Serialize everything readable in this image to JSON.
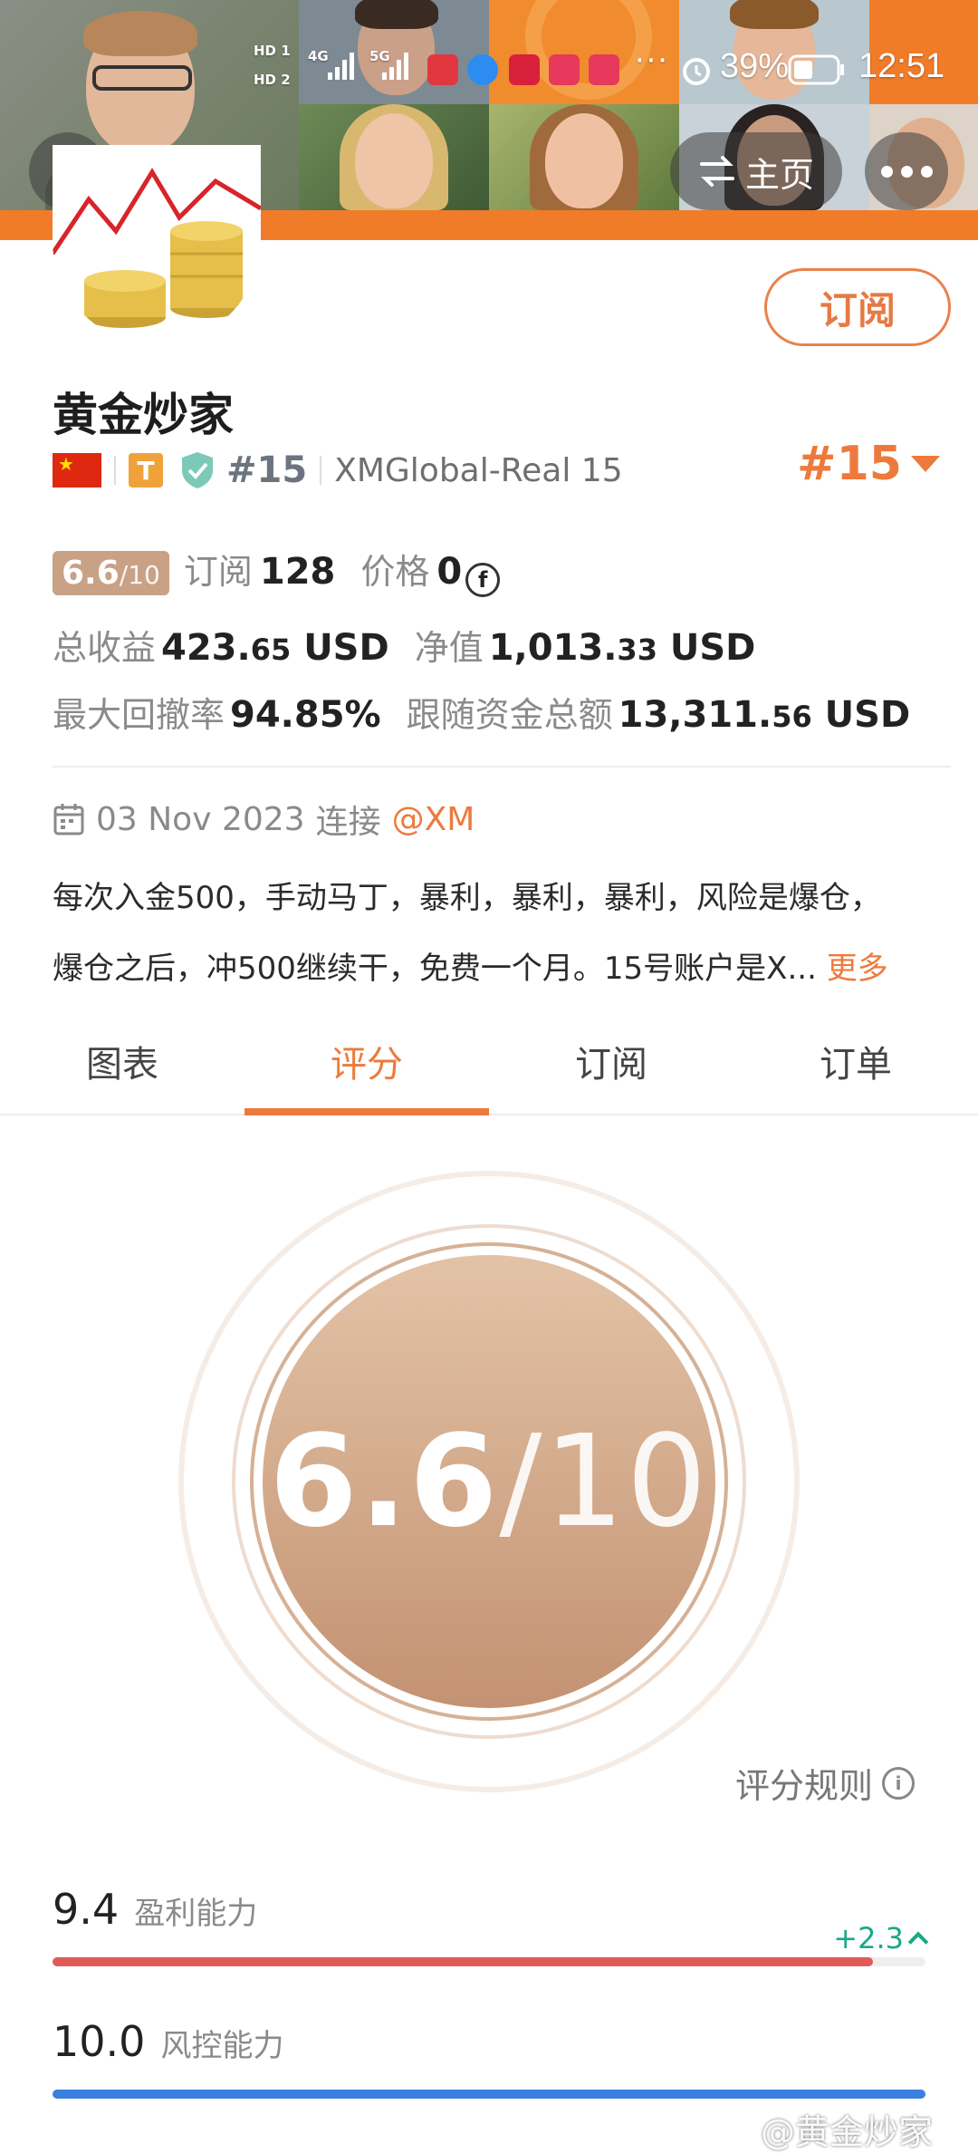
{
  "status_bar": {
    "sim1": "HD 1",
    "sim2": "HD 2",
    "net1": "4G",
    "net2": "5G",
    "battery": "39%",
    "time": "12:51"
  },
  "header": {
    "home_label": "主页"
  },
  "profile": {
    "name": "黄金炒家",
    "subscribe_label": "订阅",
    "tier_badge": "T",
    "rank_label": "#15",
    "server": "XMGlobal-Real 15",
    "rank_big": "#15"
  },
  "stats": {
    "score_main": "6.6",
    "score_of": "/10",
    "subs_label": "订阅",
    "subs_value": "128",
    "price_label": "价格",
    "price_value": "0",
    "price_currency_icon": "currency-coin-icon",
    "profit_label": "总收益",
    "profit_int": "423.",
    "profit_dec": "65",
    "profit_unit": "USD",
    "equity_label": "净值",
    "equity_int": "1,013.",
    "equity_dec": "33",
    "equity_unit": "USD",
    "drawdown_label": "最大回撤率",
    "drawdown_value": "94.85%",
    "follow_label": "跟随资金总额",
    "follow_int": "13,311.",
    "follow_dec": "56",
    "follow_unit": "USD"
  },
  "connection": {
    "date": "03 Nov 2023",
    "connect_label": "连接",
    "broker": "@XM"
  },
  "description": {
    "line1": "每次入金500，手动马丁，暴利，暴利，暴利，风险是爆仓，",
    "line2": "爆仓之后，冲500继续干，免费一个月。15号账户是X...",
    "more_label": "更多"
  },
  "tabs": [
    {
      "label": "图表"
    },
    {
      "label": "评分"
    },
    {
      "label": "订阅"
    },
    {
      "label": "订单"
    }
  ],
  "active_tab": "评分",
  "score": {
    "value": "6.6",
    "of": "/10",
    "rules_label": "评分规则"
  },
  "metrics": [
    {
      "value": "9.4",
      "name": "盈利能力",
      "delta": "+2.3",
      "fill_ratio": 0.94,
      "color": "#e05a5a"
    },
    {
      "value": "10.0",
      "name": "风控能力",
      "fill_ratio": 1.0,
      "color": "#3b7fe0"
    }
  ],
  "watermark": "@黄金炒家",
  "colors": {
    "accent": "#ed7a3c",
    "score_chip": "#c9a185",
    "positive": "#1aa88a"
  }
}
